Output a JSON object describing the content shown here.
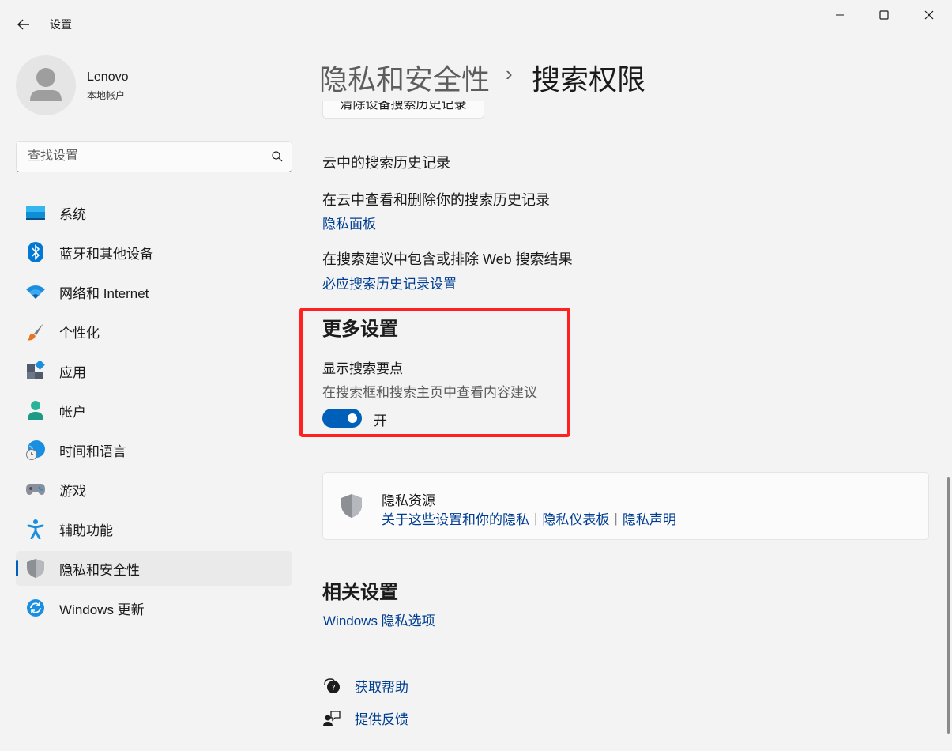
{
  "window": {
    "title": "设置"
  },
  "profile": {
    "name": "Lenovo",
    "type": "本地帐户"
  },
  "search": {
    "placeholder": "查找设置",
    "value": ""
  },
  "nav": {
    "items": [
      {
        "label": "系统",
        "icon": "monitor-icon"
      },
      {
        "label": "蓝牙和其他设备",
        "icon": "bluetooth-icon"
      },
      {
        "label": "网络和 Internet",
        "icon": "wifi-icon"
      },
      {
        "label": "个性化",
        "icon": "brush-icon"
      },
      {
        "label": "应用",
        "icon": "apps-icon"
      },
      {
        "label": "帐户",
        "icon": "person-icon"
      },
      {
        "label": "时间和语言",
        "icon": "globe-clock-icon"
      },
      {
        "label": "游戏",
        "icon": "gamepad-icon"
      },
      {
        "label": "辅助功能",
        "icon": "accessibility-icon"
      },
      {
        "label": "隐私和安全性",
        "icon": "shield-icon",
        "active": true
      },
      {
        "label": "Windows 更新",
        "icon": "update-icon"
      }
    ]
  },
  "breadcrumb": {
    "parent": "隐私和安全性",
    "separator": "›",
    "current": "搜索权限"
  },
  "content": {
    "clear_button": "清除设备搜索历史记录",
    "cloud_history_title": "云中的搜索历史记录",
    "cloud_view_text": "在云中查看和删除你的搜索历史记录",
    "privacy_dashboard_link": "隐私面板",
    "web_results_text": "在搜索建议中包含或排除 Web 搜索结果",
    "bing_history_link": "必应搜索历史记录设置",
    "more_settings_title": "更多设置",
    "highlights_title": "显示搜索要点",
    "highlights_desc": "在搜索框和搜索主页中查看内容建议",
    "toggle_state": "开",
    "toggle_on": true
  },
  "privacy_card": {
    "title": "隐私资源",
    "links": [
      "关于这些设置和你的隐私",
      "隐私仪表板",
      "隐私声明"
    ],
    "separator": "|"
  },
  "related": {
    "title": "相关设置",
    "link": "Windows 隐私选项"
  },
  "help": {
    "get_help": "获取帮助",
    "feedback": "提供反馈"
  },
  "colors": {
    "accent": "#005fb8",
    "link": "#003e92",
    "highlight_box": "#ff2020",
    "background": "#f3f3f3"
  }
}
